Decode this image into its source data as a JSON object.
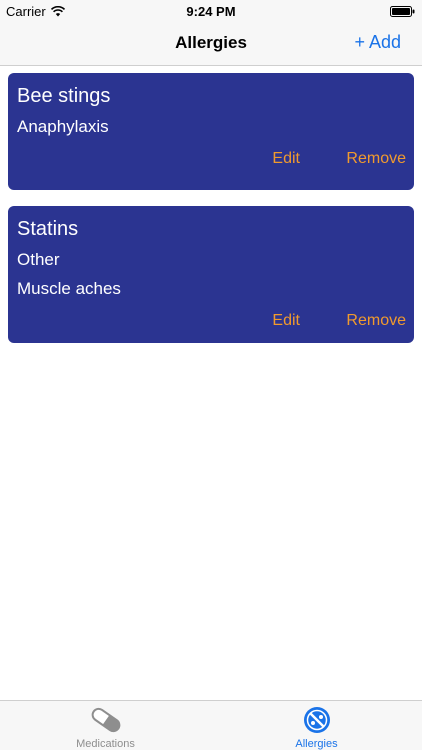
{
  "status_bar": {
    "carrier": "Carrier",
    "time": "9:24 PM"
  },
  "nav": {
    "title": "Allergies",
    "add_label": "+ Add"
  },
  "allergies": [
    {
      "name": "Bee stings",
      "reactions": [
        "Anaphylaxis"
      ],
      "edit_label": "Edit",
      "remove_label": "Remove"
    },
    {
      "name": "Statins",
      "reactions": [
        "Other",
        "Muscle aches"
      ],
      "edit_label": "Edit",
      "remove_label": "Remove"
    }
  ],
  "tabs": [
    {
      "label": "Medications",
      "icon": "pill-icon",
      "active": false
    },
    {
      "label": "Allergies",
      "icon": "allergy-icon",
      "active": true
    }
  ],
  "colors": {
    "card_bg": "#2b3491",
    "action_text": "#f09a2e",
    "accent": "#1a73e8"
  }
}
